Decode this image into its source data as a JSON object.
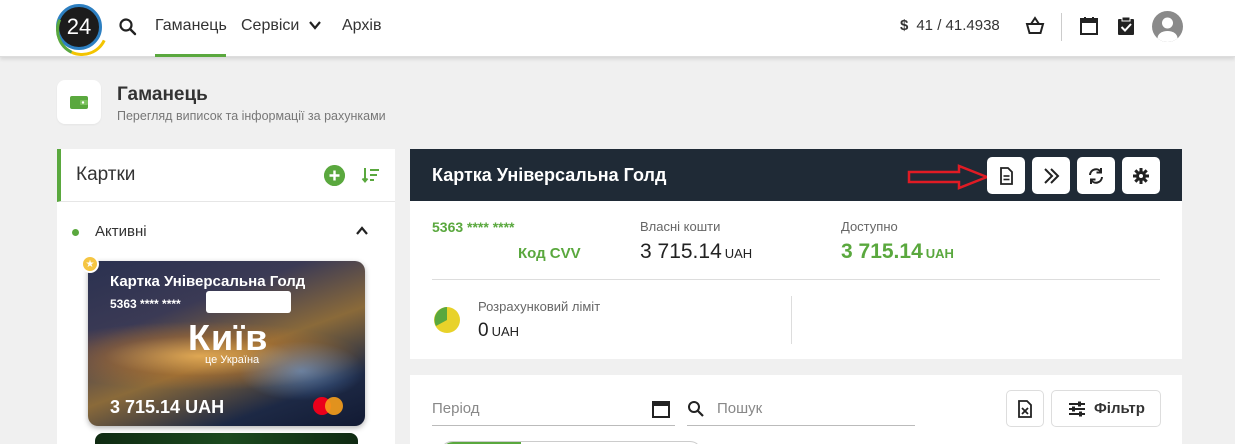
{
  "topbar": {
    "logo_text": "24",
    "nav": {
      "wallet": "Гаманець",
      "services": "Сервіси",
      "archive": "Архів"
    },
    "rate_symbol": "$",
    "rate_value": "41 / 41.4938",
    "icons": [
      "search-icon",
      "chevron-down-icon",
      "basket-icon",
      "calendar-icon",
      "clipboard-check-icon",
      "avatar-icon"
    ]
  },
  "page": {
    "title": "Гаманець",
    "subtitle": "Перегляд виписок та інформації за рахунками"
  },
  "cards_panel": {
    "title": "Картки",
    "group_label": "Активні",
    "card": {
      "name": "Картка Універсальна Голд",
      "number": "5363 **** ****",
      "city": "Київ",
      "city_sub": "це Україна",
      "balance": "3 715.14 UAH",
      "favorite_mark": "★"
    }
  },
  "detail": {
    "title": "Картка Універсальна Голд",
    "card_number": "5363 **** ****",
    "cvv_label": "Код CVV",
    "own_funds_label": "Власні кошти",
    "own_funds_value": "3 715.14",
    "available_label": "Доступно",
    "available_value": "3 715.14",
    "currency": "UAH",
    "credit_limit_label": "Розрахунковий ліміт",
    "credit_limit_value": "0"
  },
  "filters": {
    "period_placeholder": "Період",
    "search_placeholder": "Пошук",
    "filter_label": "Фільтр"
  },
  "colors": {
    "accent_green": "#5aa83e",
    "dark_header": "#1f2a36",
    "annotation_red": "#e01b24"
  }
}
